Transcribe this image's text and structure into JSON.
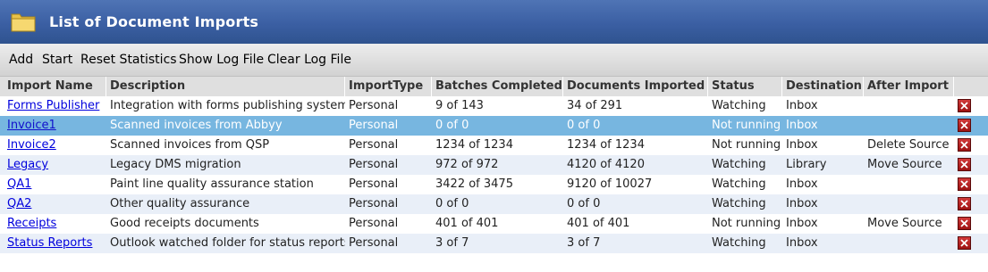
{
  "window": {
    "title": "List of Document Imports",
    "icon": "folder-icon"
  },
  "toolbar": {
    "add": "Add",
    "start": "Start",
    "reset_statistics": "Reset Statistics",
    "show_log_file": "Show Log File",
    "clear_log_file": "Clear Log File"
  },
  "table": {
    "columns": [
      "Import Name",
      "Description",
      "ImportType",
      "Batches Completed",
      "Documents Imported",
      "Status",
      "Destination",
      "After Import"
    ],
    "selected_row": 1,
    "rows": [
      {
        "name": "Forms Publisher",
        "description": "Integration with forms publishing system",
        "type": "Personal",
        "batches": "9 of 143",
        "documents": "34 of 291",
        "status": "Watching",
        "destination": "Inbox",
        "after": ""
      },
      {
        "name": "Invoice1",
        "description": "Scanned invoices from Abbyy",
        "type": "Personal",
        "batches": "0 of 0",
        "documents": "0 of 0",
        "status": "Not running",
        "destination": "Inbox",
        "after": ""
      },
      {
        "name": "Invoice2",
        "description": "Scanned invoices from QSP",
        "type": "Personal",
        "batches": "1234 of 1234",
        "documents": "1234 of 1234",
        "status": "Not running",
        "destination": "Inbox",
        "after": "Delete Source"
      },
      {
        "name": "Legacy",
        "description": "Legacy DMS migration",
        "type": "Personal",
        "batches": "972 of 972",
        "documents": "4120 of 4120",
        "status": "Watching",
        "destination": "Library",
        "after": "Move Source"
      },
      {
        "name": "QA1",
        "description": "Paint line quality assurance station",
        "type": "Personal",
        "batches": "3422 of 3475",
        "documents": "9120 of 10027",
        "status": "Watching",
        "destination": "Inbox",
        "after": ""
      },
      {
        "name": "QA2",
        "description": "Other quality assurance",
        "type": "Personal",
        "batches": "0 of 0",
        "documents": "0 of 0",
        "status": "Watching",
        "destination": "Inbox",
        "after": ""
      },
      {
        "name": "Receipts",
        "description": "Good receipts documents",
        "type": "Personal",
        "batches": "401 of 401",
        "documents": "401 of 401",
        "status": "Not running",
        "destination": "Inbox",
        "after": "Move Source"
      },
      {
        "name": "Status Reports",
        "description": "Outlook watched folder for status reports",
        "type": "Personal",
        "batches": "3 of 7",
        "documents": "3 of 7",
        "status": "Watching",
        "destination": "Inbox",
        "after": ""
      }
    ]
  },
  "colors": {
    "title_bar": "#3b5fa3",
    "selected_row": "#77b6e0",
    "alt_row": "#e9eff8",
    "link": "#0000dd",
    "delete": "#b52020"
  }
}
